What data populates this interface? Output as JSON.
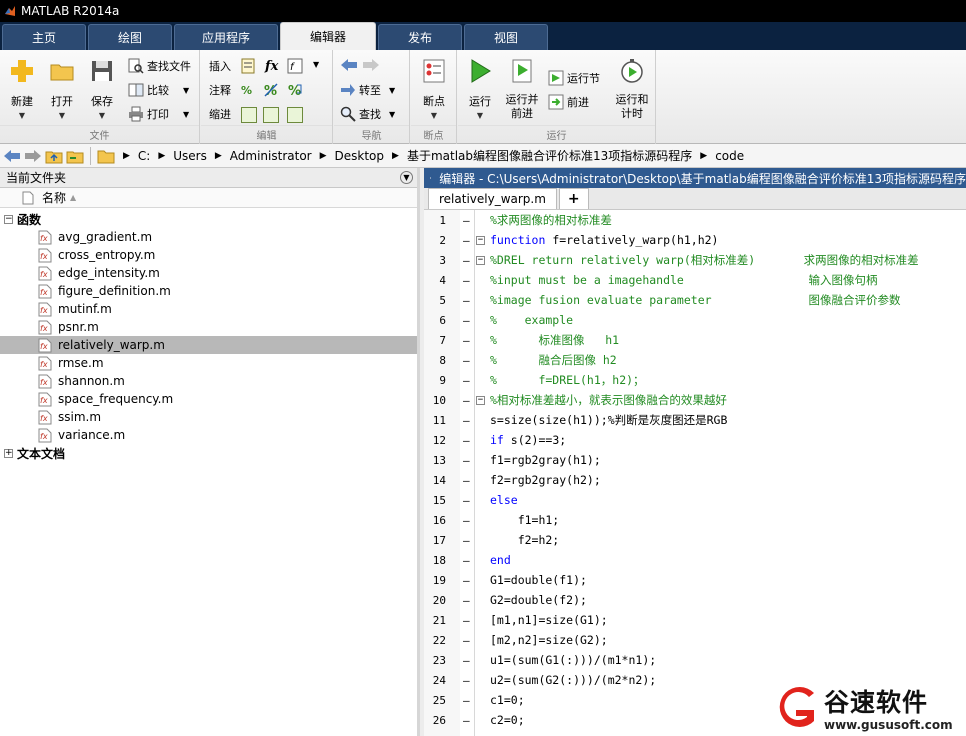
{
  "window": {
    "title": "MATLAB R2014a"
  },
  "tabs": [
    "主页",
    "绘图",
    "应用程序",
    "编辑器",
    "发布",
    "视图"
  ],
  "ribbon": {
    "file": {
      "new": "新建",
      "open": "打开",
      "save": "保存",
      "find_files": "查找文件",
      "compare": "比较",
      "print": "打印",
      "group": "文件"
    },
    "edit": {
      "insert": "插入",
      "fx": "fx",
      "comment": "注释",
      "percent": "%",
      "indent": "缩进",
      "group": "编辑"
    },
    "navigate": {
      "goto": "转至",
      "find": "查找",
      "group": "导航"
    },
    "breakpoints": {
      "label": "断点",
      "group": "断点"
    },
    "run": {
      "run": "运行",
      "run_advance_1": "运行并",
      "run_advance_2": "前进",
      "run_section": "运行节",
      "advance": "前进",
      "run_time_1": "运行和",
      "run_time_2": "计时",
      "group": "运行"
    }
  },
  "path": [
    "C:",
    "Users",
    "Administrator",
    "Desktop",
    "基于matlab编程图像融合评价标准13项指标源码程序",
    "code"
  ],
  "current_folder": {
    "title": "当前文件夹",
    "column_name": "名称",
    "folder_functions": "函数",
    "files": [
      "avg_gradient.m",
      "cross_entropy.m",
      "edge_intensity.m",
      "figure_definition.m",
      "mutinf.m",
      "psnr.m",
      "relatively_warp.m",
      "rmse.m",
      "shannon.m",
      "space_frequency.m",
      "ssim.m",
      "variance.m"
    ],
    "selected": "relatively_warp.m",
    "folder_docs": "文本文档"
  },
  "editor": {
    "title": "编辑器 - C:\\Users\\Administrator\\Desktop\\基于matlab编程图像融合评价标准13项指标源码程序",
    "tab": "relatively_warp.m",
    "add_tab": "+",
    "lines": [
      {
        "n": "1",
        "t": "%求两图像的相对标准差"
      },
      {
        "n": "2",
        "t": "function f=relatively_warp(h1,h2)"
      },
      {
        "n": "3",
        "t": "%DREL return relatively warp(相对标准差)       求两图像的相对标准差"
      },
      {
        "n": "4",
        "t": "%input must be a imagehandle                  输入图像句柄"
      },
      {
        "n": "5",
        "t": "%image fusion evaluate parameter              图像融合评价参数"
      },
      {
        "n": "6",
        "t": "%    example"
      },
      {
        "n": "7",
        "t": "%      标准图像   h1"
      },
      {
        "n": "8",
        "t": "%      融合后图像 h2"
      },
      {
        "n": "9",
        "t": "%      f=DREL(h1，h2)；"
      },
      {
        "n": "10",
        "t": "%相对标准差越小，就表示图像融合的效果越好"
      },
      {
        "n": "11",
        "t": "s=size(size(h1));%判断是灰度图还是RGB"
      },
      {
        "n": "12",
        "t": "if s(2)==3;"
      },
      {
        "n": "13",
        "t": "f1=rgb2gray(h1);"
      },
      {
        "n": "14",
        "t": "f2=rgb2gray(h2);"
      },
      {
        "n": "15",
        "t": "else"
      },
      {
        "n": "16",
        "t": "    f1=h1;"
      },
      {
        "n": "17",
        "t": "    f2=h2;"
      },
      {
        "n": "18",
        "t": "end"
      },
      {
        "n": "19",
        "t": "G1=double(f1);"
      },
      {
        "n": "20",
        "t": "G2=double(f2);"
      },
      {
        "n": "21",
        "t": "[m1,n1]=size(G1);"
      },
      {
        "n": "22",
        "t": "[m2,n2]=size(G2);"
      },
      {
        "n": "23",
        "t": "u1=(sum(G1(:)))/(m1*n1);"
      },
      {
        "n": "24",
        "t": "u2=(sum(G2(:)))/(m2*n2);"
      },
      {
        "n": "25",
        "t": "c1=0;"
      },
      {
        "n": "26",
        "t": "c2=0;"
      }
    ]
  },
  "watermark": {
    "title": "谷速软件",
    "url": "www.gususoft.com"
  }
}
